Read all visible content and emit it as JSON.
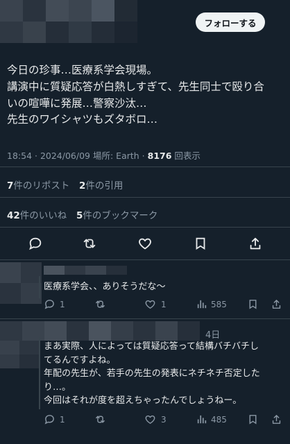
{
  "header": {
    "follow_label": "フォローする"
  },
  "tweet": {
    "lines": [
      "今日の珍事…医療系学会現場。",
      "講演中に質疑応答が白熱しすぎて、先生同士で殴り合",
      "いの喧嘩に発展…警察沙汰…",
      "先生のワイシャツもズタボロ…"
    ],
    "time": "18:54",
    "date": "2024/06/09",
    "location_label": "場所: Earth",
    "views_count": "8176",
    "views_label": "回表示",
    "reposts_count": "7",
    "reposts_label": "件のリポスト",
    "quotes_count": "2",
    "quotes_label": "件の引用",
    "likes_count": "42",
    "likes_label": "件のいいね",
    "bookmarks_count": "5",
    "bookmarks_label": "件のブックマーク"
  },
  "replies": [
    {
      "text_lines": [
        "医療系学会、、ありそうだな〜"
      ],
      "reply_count": "1",
      "like_count": "1",
      "view_count": "585"
    },
    {
      "time_label": "4日",
      "text_lines": [
        "まあ実際、人によっては質疑応答って結構バチバチし",
        "てるんですよね。",
        "年配の先生が、若手の先生の発表にネチネチ否定した",
        "り…。",
        "今回はそれが度を超えちゃったんでしょうねー。"
      ],
      "reply_count": "1",
      "like_count": "3",
      "view_count": "485"
    }
  ],
  "icons": {
    "reply": "reply-icon",
    "repost": "repost-icon",
    "like": "heart-icon",
    "bookmark": "bookmark-icon",
    "share": "share-icon",
    "views": "views-icon"
  }
}
